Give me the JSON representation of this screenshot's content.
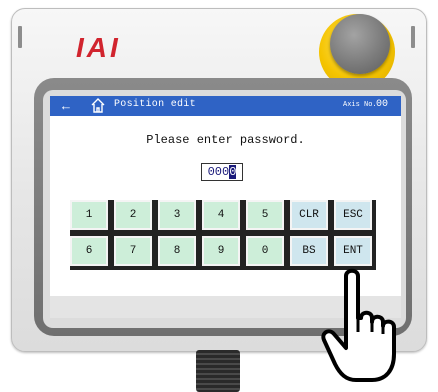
{
  "brand": {
    "logo_text": "IAI",
    "logo_color": "#d1242e"
  },
  "screen": {
    "title": "Position edit",
    "axis_label": "Axis No.",
    "axis_value": "00",
    "titlebar_color": "#2f63c5",
    "icons": {
      "back": "back-arrow-icon",
      "home": "home-icon"
    }
  },
  "prompt": "Please enter password.",
  "password": {
    "value_before_cursor": "000",
    "cursor_char": "0"
  },
  "keypad": {
    "row1": [
      "1",
      "2",
      "3",
      "4",
      "5",
      "CLR",
      "ESC"
    ],
    "row2": [
      "6",
      "7",
      "8",
      "9",
      "0",
      "BS",
      "ENT"
    ],
    "number_key_color": "#cdeed9",
    "function_key_color": "#cfe6ee"
  },
  "pointer": {
    "icon": "pointing-hand-icon",
    "target": "ENT"
  }
}
